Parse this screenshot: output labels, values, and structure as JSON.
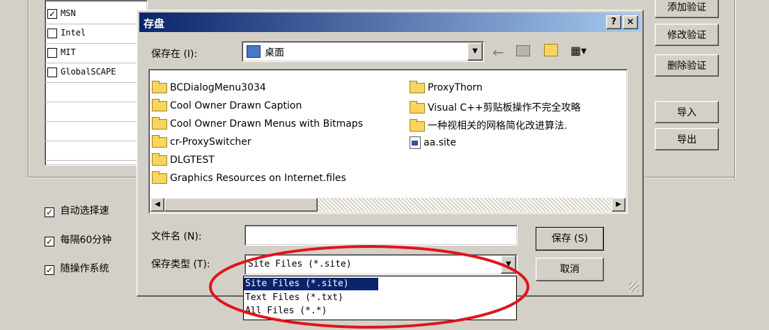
{
  "background": {
    "list_items": [
      {
        "label": "MSN",
        "checked": true
      },
      {
        "label": "Intel",
        "checked": false
      },
      {
        "label": "MIT",
        "checked": false
      },
      {
        "label": "GlobalSCAPE",
        "checked": false
      }
    ],
    "buttons": {
      "add_verify": "添加验证",
      "modify_verify": "修改验证",
      "delete_verify": "删除验证",
      "import": "导入",
      "export": "导出"
    },
    "options": [
      {
        "label": "自动选择速",
        "checked": true
      },
      {
        "label": "每隔60分钟",
        "checked": true
      },
      {
        "label": "随操作系统",
        "checked": true
      }
    ]
  },
  "dialog": {
    "title": "存盘",
    "help_button": "?",
    "close_button": "×",
    "save_in_label": "保存在 (I):",
    "save_in_value": "桌面",
    "files": [
      {
        "name": "BCDialogMenu3034",
        "type": "folder"
      },
      {
        "name": "Cool Owner Drawn Caption",
        "type": "folder"
      },
      {
        "name": "Cool Owner Drawn Menus with Bitmaps",
        "type": "folder"
      },
      {
        "name": "cr-ProxySwitcher",
        "type": "folder"
      },
      {
        "name": "DLGTEST",
        "type": "folder"
      },
      {
        "name": "Graphics Resources on Internet.files",
        "type": "folder"
      },
      {
        "name": "ProxyThorn",
        "type": "folder"
      },
      {
        "name": "Visual C++剪贴板操作不完全攻略",
        "type": "folder"
      },
      {
        "name": "一种视相关的网格简化改进算法.",
        "type": "folder"
      },
      {
        "name": "aa.site",
        "type": "file"
      }
    ],
    "filename_label": "文件名 (N):",
    "filename_value": "",
    "filetype_label": "保存类型 (T):",
    "filetype_value": "Site Files (*.site)",
    "filetype_options": [
      "Site Files (*.site)",
      "Text Files (*.txt)",
      "All Files (*.*)"
    ],
    "save_button": "保存 (S)",
    "cancel_button": "取消"
  },
  "annotation": {
    "color": "#e0141a",
    "shape": "ellipse"
  }
}
